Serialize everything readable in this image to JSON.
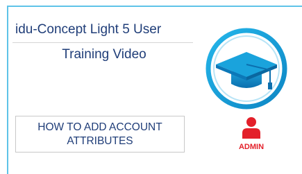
{
  "card": {
    "title_line1": "idu-Concept Light 5 User",
    "title_line2": "Training Video",
    "topic_line1": "HOW TO ADD ACCOUNT",
    "topic_line2": "ATTRIBUTES",
    "role_label": "ADMIN"
  },
  "icons": {
    "logo": "graduation-cap-icon",
    "role": "user-icon"
  },
  "colors": {
    "title_text": "#1f3d78",
    "accent_blue": "#1aa3dc",
    "admin_red": "#e3202a",
    "border": "#5ec3e8"
  }
}
